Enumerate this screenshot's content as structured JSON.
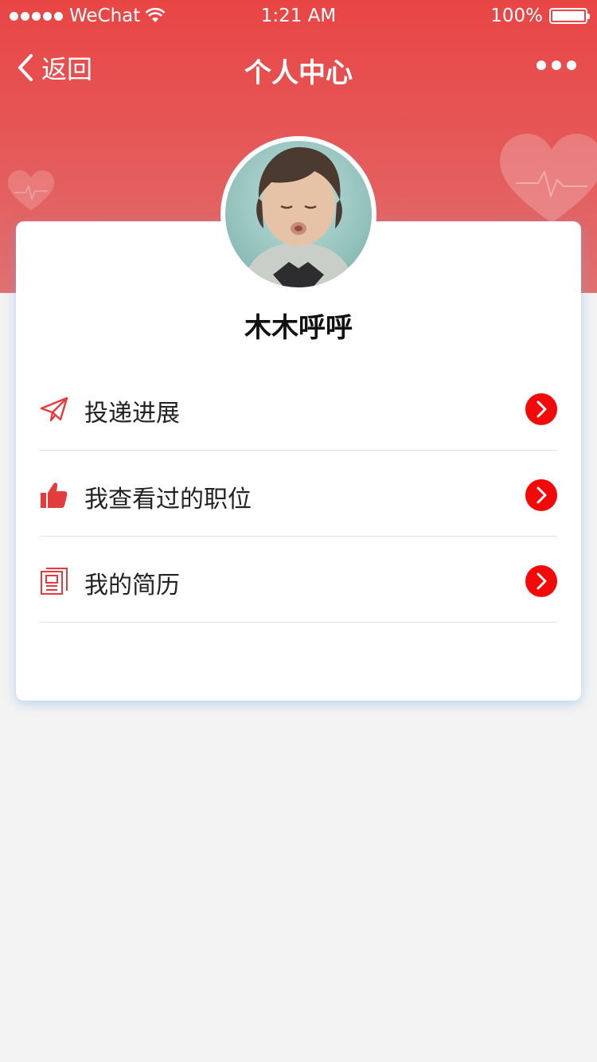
{
  "status_bar": {
    "carrier": "WeChat",
    "time": "1:21 AM",
    "battery": "100%"
  },
  "nav": {
    "back_label": "返回",
    "title": "个人中心"
  },
  "profile": {
    "username": "木木呼呼"
  },
  "menu": [
    {
      "label": "投递进展",
      "icon": "paper-plane-icon"
    },
    {
      "label": "我查看过的职位",
      "icon": "thumbs-up-icon"
    },
    {
      "label": "我的简历",
      "icon": "resume-icon"
    }
  ],
  "colors": {
    "header_red": "#e94545",
    "arrow_red": "#f20a0a",
    "icon_red": "#e43c3c",
    "page_bg": "#f3f3f3"
  }
}
